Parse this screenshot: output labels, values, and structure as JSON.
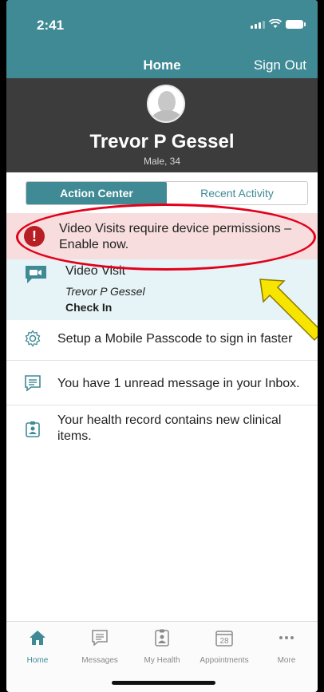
{
  "status_bar": {
    "time": "2:41"
  },
  "nav": {
    "title": "Home",
    "sign_out": "Sign Out"
  },
  "profile": {
    "name": "Trevor P Gessel",
    "details": "Male, 34"
  },
  "segments": {
    "action_center": "Action Center",
    "recent_activity": "Recent Activity",
    "selected": "Action Center"
  },
  "alert": {
    "icon": "exclamation-icon",
    "text": "Video Visits require device permissions – Enable now."
  },
  "video_visit": {
    "icon": "video-chat-icon",
    "title": "Video Visit",
    "patient": "Trevor P Gessel",
    "action": "Check In"
  },
  "items": [
    {
      "icon": "gear-icon",
      "text": "Setup a Mobile Passcode to sign in faster"
    },
    {
      "icon": "message-icon",
      "text": "You have 1 unread message in your Inbox."
    },
    {
      "icon": "health-record-icon",
      "text": "Your health record contains new clinical items."
    }
  ],
  "tabs": [
    {
      "icon": "home-icon",
      "label": "Home",
      "active": true
    },
    {
      "icon": "messages-icon",
      "label": "Messages"
    },
    {
      "icon": "my-health-icon",
      "label": "My Health"
    },
    {
      "icon": "calendar-icon",
      "label": "Appointments",
      "calendar_day": "28"
    },
    {
      "icon": "more-icon",
      "label": "More"
    }
  ],
  "colors": {
    "accent": "#3f8a95",
    "alert_bg": "#f7dddd",
    "alert_icon": "#b81f24",
    "video_bg": "#e6f4f7",
    "annotation_red": "#e3001b",
    "annotation_arrow": "#f7e400"
  }
}
